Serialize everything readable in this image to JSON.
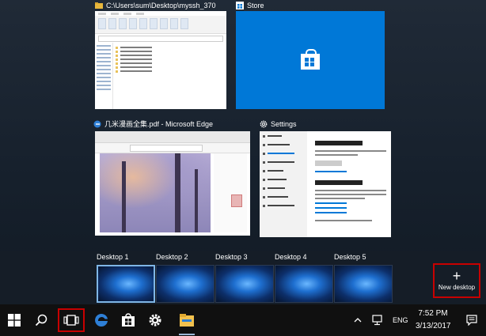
{
  "windows": {
    "explorer": {
      "title": "C:\\Users\\sum\\Desktop\\myssh_370"
    },
    "store": {
      "title": "Store"
    },
    "edge": {
      "title": "几米漫画全集.pdf - Microsoft Edge"
    },
    "settings": {
      "title": "Settings"
    }
  },
  "desktops": [
    {
      "label": "Desktop 1",
      "active": true
    },
    {
      "label": "Desktop 2",
      "active": false
    },
    {
      "label": "Desktop 3",
      "active": false
    },
    {
      "label": "Desktop 4",
      "active": false
    },
    {
      "label": "Desktop 5",
      "active": false
    }
  ],
  "new_desktop": {
    "label": "New desktop"
  },
  "taskbar": {
    "language": "ENG",
    "time": "7:52 PM",
    "date": "3/13/2017",
    "pinned_icons": [
      "windows-start-icon",
      "search-icon",
      "task-view-icon",
      "edge-icon",
      "store-icon",
      "settings-gear-icon",
      "file-explorer-icon"
    ]
  },
  "colors": {
    "accent": "#0078d7",
    "highlight_border": "#c80000",
    "taskbar_bg": "#101010",
    "taskview_bg": "#1a2433"
  }
}
